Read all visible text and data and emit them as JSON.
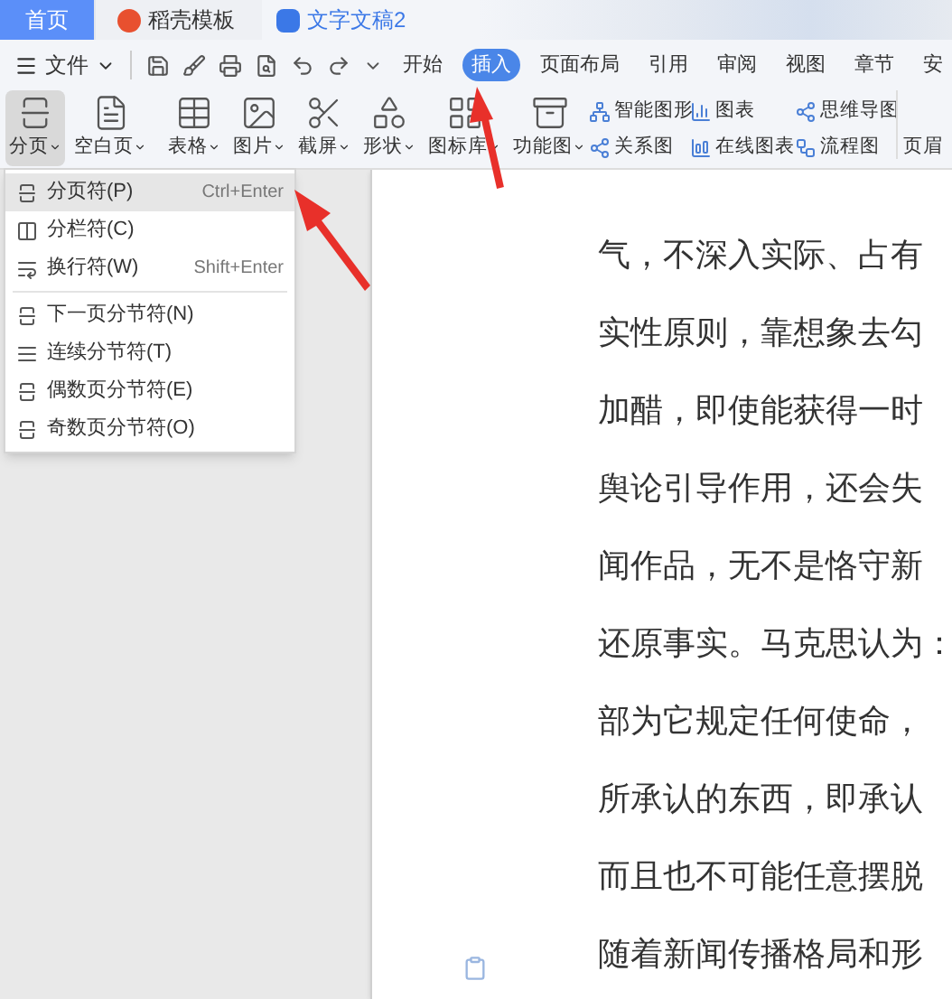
{
  "title_tabs": [
    {
      "label": "首页",
      "kind": "home",
      "selected": false
    },
    {
      "label": "稻壳模板",
      "kind": "docer",
      "selected": false
    },
    {
      "label": "文字文稿2",
      "kind": "doc",
      "selected": true
    }
  ],
  "file_menu": "文件",
  "menu_tabs": [
    {
      "label": "开始",
      "selected": false
    },
    {
      "label": "插入",
      "selected": true
    },
    {
      "label": "页面布局",
      "selected": false
    },
    {
      "label": "引用",
      "selected": false
    },
    {
      "label": "审阅",
      "selected": false
    },
    {
      "label": "视图",
      "selected": false
    },
    {
      "label": "章节",
      "selected": false
    },
    {
      "label": "安",
      "selected": false
    }
  ],
  "ribbon_large": [
    {
      "label": "分页",
      "kind": "pagebreak",
      "selected": true
    },
    {
      "label": "空白页",
      "kind": "blank",
      "selected": false
    },
    {
      "label": "表格",
      "kind": "table",
      "selected": false
    },
    {
      "label": "图片",
      "kind": "image",
      "selected": false
    },
    {
      "label": "截屏",
      "kind": "crop",
      "selected": false
    },
    {
      "label": "形状",
      "kind": "shapes",
      "selected": false
    },
    {
      "label": "图标库",
      "kind": "icons",
      "selected": false
    },
    {
      "label": "功能图",
      "kind": "func",
      "selected": false
    }
  ],
  "ribbon_small": [
    {
      "label": "智能图形",
      "kind": "smart"
    },
    {
      "label": "关系图",
      "kind": "relation"
    },
    {
      "label": "图表",
      "kind": "chart"
    },
    {
      "label": "在线图表",
      "kind": "online"
    },
    {
      "label": "思维导图",
      "kind": "mind"
    },
    {
      "label": "流程图",
      "kind": "flow"
    }
  ],
  "ribbon_cut": "页眉",
  "dropdown": [
    {
      "label": "分页符(P)",
      "shortcut": "Ctrl+Enter",
      "kind": "pagebreak",
      "selected": true
    },
    {
      "label": "分栏符(C)",
      "kind": "column",
      "selected": false
    },
    {
      "label": "换行符(W)",
      "shortcut": "Shift+Enter",
      "kind": "line",
      "selected": false
    },
    {
      "label": "下一页分节符(N)",
      "kind": "pagebreak",
      "selected": false
    },
    {
      "label": "连续分节符(T)",
      "kind": "continuous",
      "selected": false
    },
    {
      "label": "偶数页分节符(E)",
      "kind": "evenodd",
      "selected": false
    },
    {
      "label": "奇数页分节符(O)",
      "kind": "evenodd",
      "selected": false
    }
  ],
  "document_lines": [
    "气，不深入实际、占有",
    "实性原则，靠想象去勾",
    "加醋，即使能获得一时",
    "舆论引导作用，还会失",
    "闻作品，无不是恪守新",
    "还原事实。马克思认为：",
    "部为它规定任何使命，",
    "所承认的东西，即承认",
    "而且也不可能任意摆脱",
    "随着新闻传播格局和形"
  ]
}
